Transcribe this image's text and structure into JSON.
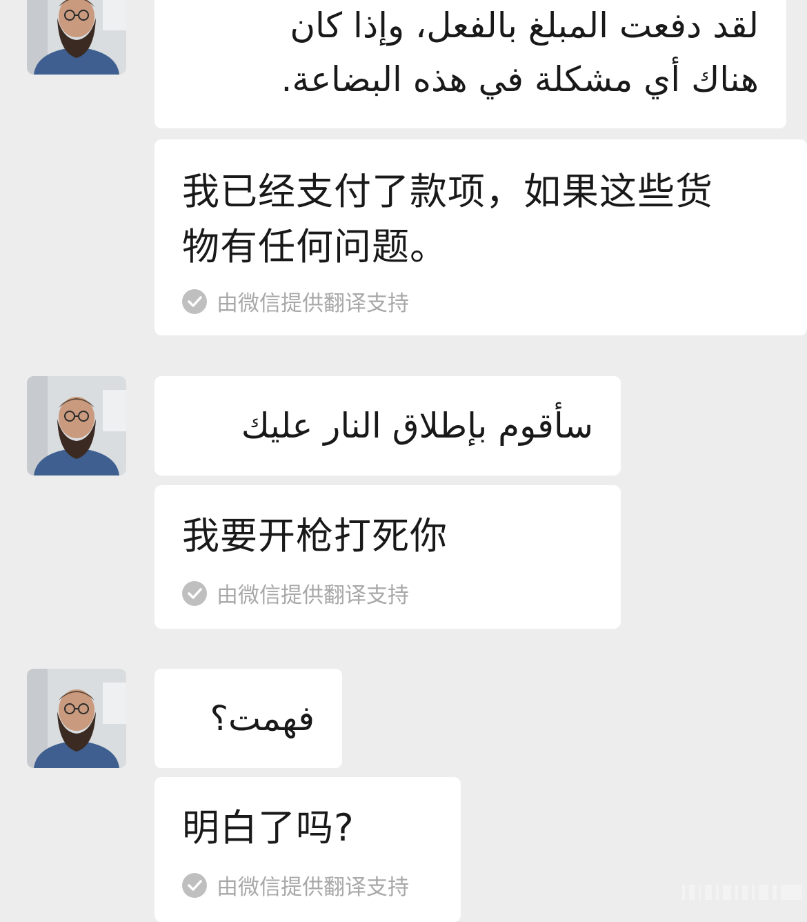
{
  "messages": [
    {
      "original": "لقد دفعت المبلغ بالفعل، وإذا كان هناك أي مشكلة في هذه البضاعة.",
      "original_line1": "لقد دفعت المبلغ بالفعل، وإذا كان",
      "original_line2": "هناك أي مشكلة في هذه البضاعة.",
      "translation_line1": "我已经支付了款项，如果这些货",
      "translation_line2": "物有任何问题。",
      "credit": "由微信提供翻译支持"
    },
    {
      "original": "سأقوم بإطلاق النار عليك",
      "translation": "我要开枪打死你",
      "credit": "由微信提供翻译支持"
    },
    {
      "original": "فهمت؟",
      "translation": "明白了吗?",
      "credit": "由微信提供翻译支持"
    }
  ],
  "colors": {
    "background": "#ededed",
    "bubble": "#ffffff",
    "credit_text": "#a8a8a8",
    "check_icon": "#bfbfbf"
  },
  "icons": {
    "avatar": "user-avatar-photo",
    "credit": "check-circle-icon"
  }
}
